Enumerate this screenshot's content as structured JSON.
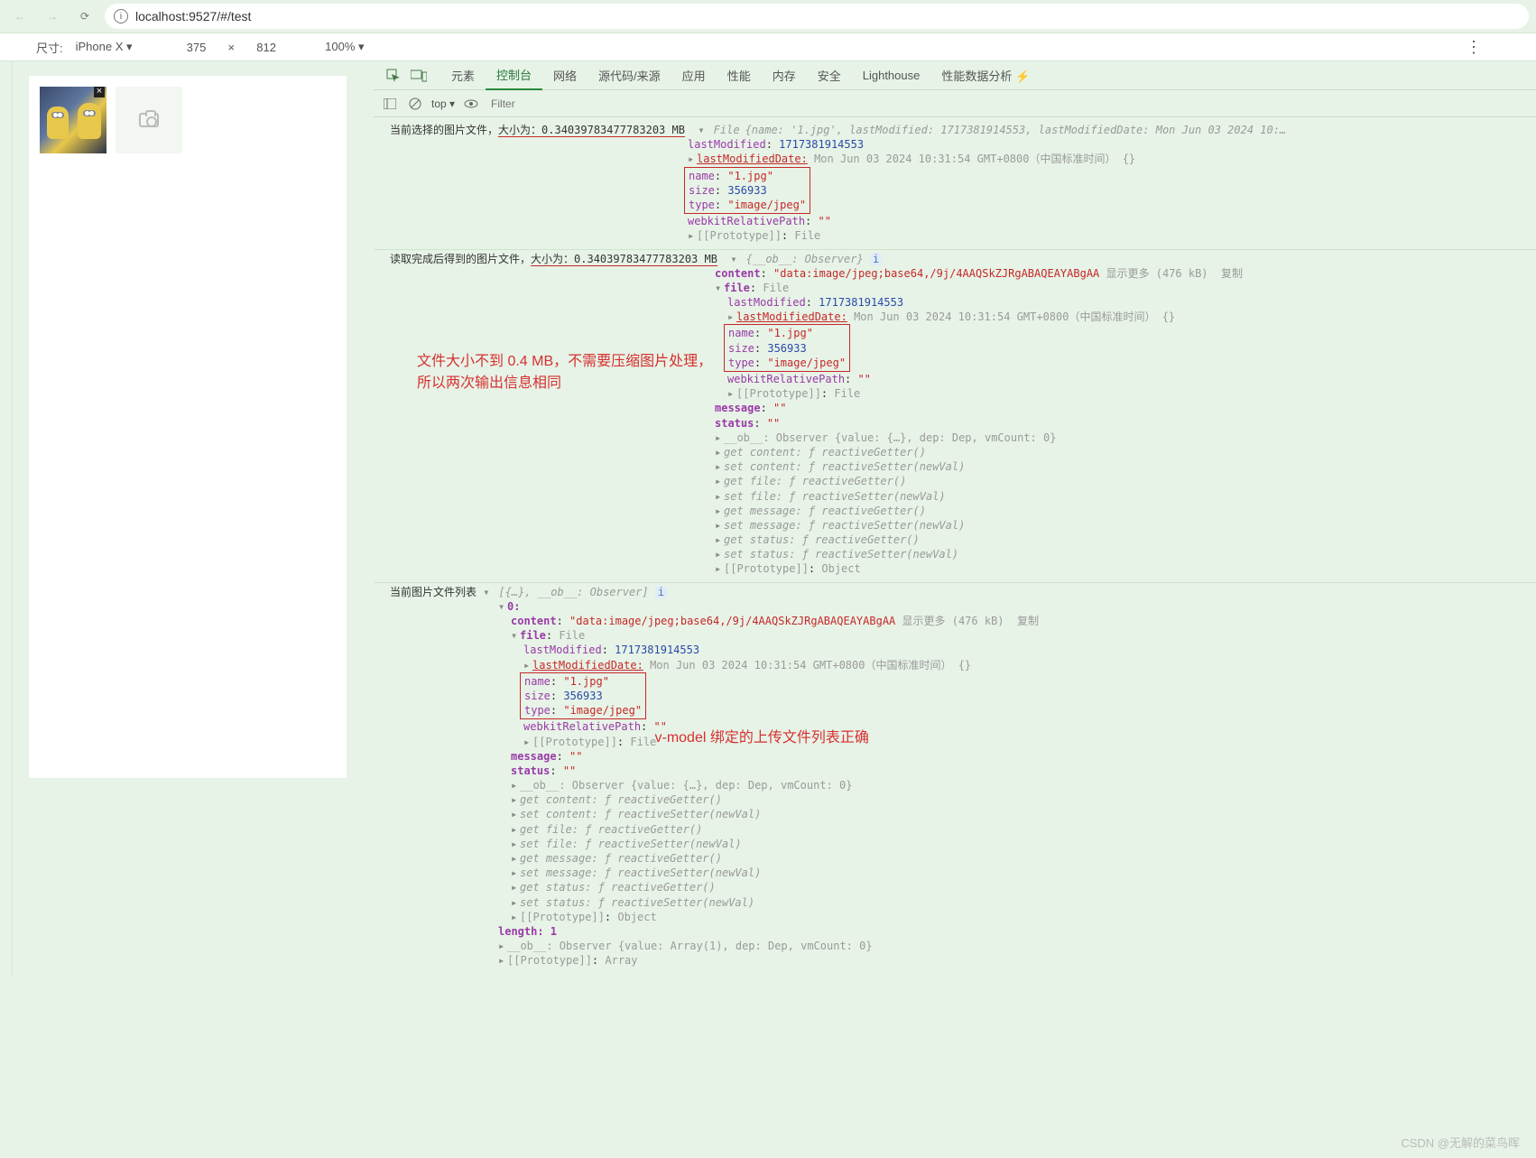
{
  "browser": {
    "url": "localhost:9527/#/test"
  },
  "device_bar": {
    "label": "尺寸:",
    "device": "iPhone X ▾",
    "w": "375",
    "x": "×",
    "h": "812",
    "zoom": "100% ▾"
  },
  "devtools": {
    "tabs": [
      "元素",
      "控制台",
      "网络",
      "源代码/来源",
      "应用",
      "性能",
      "内存",
      "安全",
      "Lighthouse",
      "性能数据分析 ⚡"
    ],
    "active_tab": "控制台",
    "top": "top ▾",
    "filter_ph": "Filter"
  },
  "log1": {
    "prefix": "当前选择的图片文件，",
    "mid": "大小为：0.34039783477783203 MB",
    "file_label": " File ",
    "inline": "{name: '1.jpg', lastModified: 1717381914553, lastModifiedDate: Mon Jun 03 2024 10:…",
    "lastModified": "1717381914553",
    "lastModifiedDate_v": "Mon Jun 03 2024 10:31:54 GMT+0800（中国标准时间）  {}",
    "name_v": "\"1.jpg\"",
    "size_v": "356933",
    "type_v": "\"image/jpeg\"",
    "webkit_v": "\"\"",
    "proto_v": "File"
  },
  "log2": {
    "prefix": "读取完成后得到的图片文件，",
    "mid": "大小为：0.34039783477783203 MB",
    "obs": "{__ob__: Observer}",
    "content_v": "\"data:image/jpeg;base64,/9j/4AAQSkZJRgABAQEAYABgAA",
    "show_more": "显示更多 (476 kB)",
    "copy": "复制",
    "file_label": "File",
    "lastModified": "1717381914553",
    "lastModifiedDate_v": "Mon Jun 03 2024 10:31:54 GMT+0800（中国标准时间）  {}",
    "name_v": "\"1.jpg\"",
    "size_v": "356933",
    "type_v": "\"image/jpeg\"",
    "webkit_v": "\"\"",
    "proto_file": "File",
    "message_v": "\"\"",
    "status_v": "\"\"",
    "ob_line": "__ob__: Observer  {value: {…}, dep: Dep, vmCount: 0}",
    "get_content": "get content: ƒ reactiveGetter()",
    "set_content": "set content: ƒ reactiveSetter(newVal)",
    "get_file": "get file: ƒ reactiveGetter()",
    "set_file": "set file: ƒ reactiveSetter(newVal)",
    "get_message": "get message: ƒ reactiveGetter()",
    "set_message": "set message: ƒ reactiveSetter(newVal)",
    "get_status": "get status: ƒ reactiveGetter()",
    "set_status": "set status: ƒ reactiveSetter(newVal)",
    "proto_obj": "Object"
  },
  "annotation1": {
    "line1": "文件大小不到 0.4 MB，不需要压缩图片处理，",
    "line2": "所以两次输出信息相同"
  },
  "log3": {
    "prefix": "当前图片文件列表  ",
    "header": "[{…}, __ob__: Observer]",
    "zero": "0:",
    "content_v": "\"data:image/jpeg;base64,/9j/4AAQSkZJRgABAQEAYABgAA",
    "show_more": "显示更多 (476 kB)",
    "copy": "复制",
    "file_label": "File",
    "lastModified": "1717381914553",
    "lastModifiedDate_v": "Mon Jun 03 2024 10:31:54 GMT+0800（中国标准时间）  {}",
    "name_v": "\"1.jpg\"",
    "size_v": "356933",
    "type_v": "\"image/jpeg\"",
    "webkit_v": "\"\"",
    "proto_file": "File",
    "message_v": "\"\"",
    "status_v": "\"\"",
    "ob_line": "__ob__: Observer  {value: {…}, dep: Dep, vmCount: 0}",
    "get_content": "get content: ƒ reactiveGetter()",
    "set_content": "set content: ƒ reactiveSetter(newVal)",
    "get_file": "get file: ƒ reactiveGetter()",
    "set_file": "set file: ƒ reactiveSetter(newVal)",
    "get_message": "get message: ƒ reactiveGetter()",
    "set_message": "set message: ƒ reactiveSetter(newVal)",
    "get_status": "get status: ƒ reactiveGetter()",
    "set_status": "set status: ƒ reactiveSetter(newVal)",
    "proto_obj": "Object",
    "length": "length: 1",
    "ob_arr": "__ob__: Observer  {value: Array(1), dep: Dep, vmCount: 0}",
    "proto_arr": "Array"
  },
  "annotation2": "v-model 绑定的上传文件列表正确",
  "watermark": "CSDN @无解的菜鸟晖",
  "labels": {
    "lastModified": "lastModified",
    "lastModifiedDate": "lastModifiedDate:",
    "name": "name",
    "size": "size",
    "type": "type",
    "webkit": "webkitRelativePath",
    "proto": "[[Prototype]]",
    "content": "content",
    "file": "file",
    "message": "message",
    "status": "status"
  },
  "info_i": "i"
}
